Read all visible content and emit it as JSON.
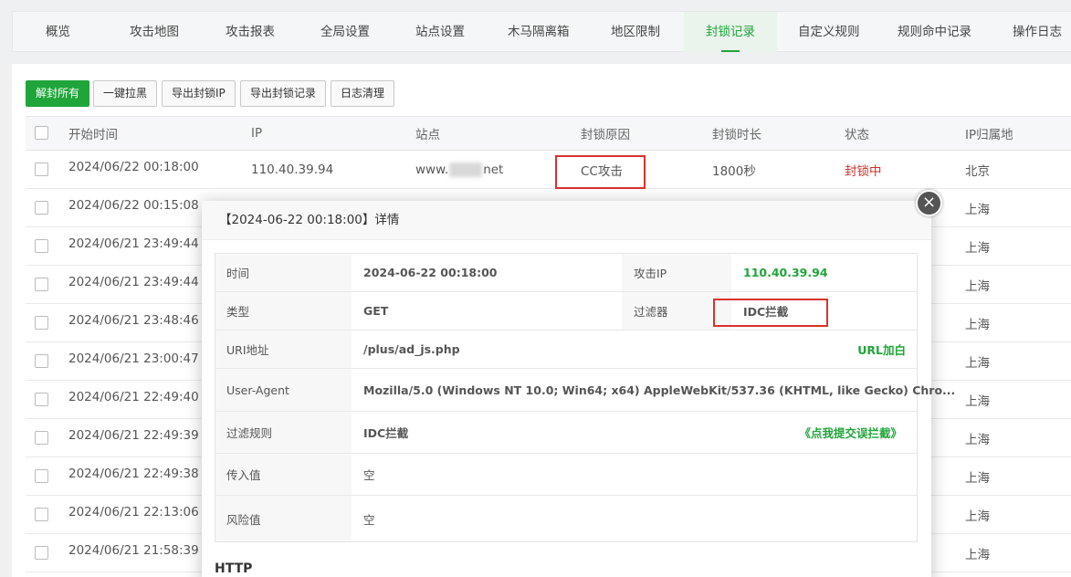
{
  "tabs": [
    "概览",
    "攻击地图",
    "攻击报表",
    "全局设置",
    "站点设置",
    "木马隔离箱",
    "地区限制",
    "封锁记录",
    "自定义规则",
    "规则命中记录",
    "操作日志"
  ],
  "toolbar": {
    "unblock_all": "解封所有",
    "blacklist": "一键拉黑",
    "export_ip": "导出封锁IP",
    "export_records": "导出封锁记录",
    "clear_log": "日志清理"
  },
  "table": {
    "headers": [
      "开始时间",
      "IP",
      "站点",
      "封锁原因",
      "封锁时长",
      "状态",
      "IP归属地"
    ],
    "first_row": {
      "time": "2024/06/22 00:18:00",
      "ip": "110.40.39.94",
      "site_prefix": "www.",
      "site_suffix": "net",
      "reason": "CC攻击",
      "duration": "1800秒",
      "status": "封锁中",
      "location": "北京"
    },
    "other_times": [
      "2024/06/22 00:15:08",
      "2024/06/21 23:49:44",
      "2024/06/21 23:49:44",
      "2024/06/21 23:48:46",
      "2024/06/21 23:00:47",
      "2024/06/21 22:49:40",
      "2024/06/21 22:49:39",
      "2024/06/21 22:49:38",
      "2024/06/21 22:13:06",
      "2024/06/21 21:58:39"
    ],
    "other_locations": [
      "上海",
      "上海",
      "上海",
      "上海",
      "上海",
      "上海",
      "上海",
      "上海",
      "上海",
      "上海"
    ]
  },
  "modal": {
    "title": "【2024-06-22 00:18:00】详情",
    "close_glyph": "×",
    "time_label": "时间",
    "time_value": "2024-06-22 00:18:00",
    "attack_ip_label": "攻击IP",
    "attack_ip_value": "110.40.39.94",
    "type_label": "类型",
    "type_value": "GET",
    "filter_label": "过滤器",
    "filter_value": "IDC拦截",
    "uri_label": "URI地址",
    "uri_value": "/plus/ad_js.php",
    "uri_whitelist": "URL加白",
    "ua_label": "User-Agent",
    "ua_value": "Mozilla/5.0 (Windows NT 10.0; Win64; x64) AppleWebKit/537.36 (KHTML, like Gecko) Chro...",
    "rule_label": "过滤规则",
    "rule_value": "IDC拦截",
    "rule_report": "《点我提交误拦截》",
    "input_label": "传入值",
    "input_value": "空",
    "risk_label": "风险值",
    "risk_value": "空",
    "http_heading": "HTTP"
  },
  "colors": {
    "accent": "#20a53a",
    "danger": "#d0302b",
    "highlight_box": "#d9322d"
  }
}
